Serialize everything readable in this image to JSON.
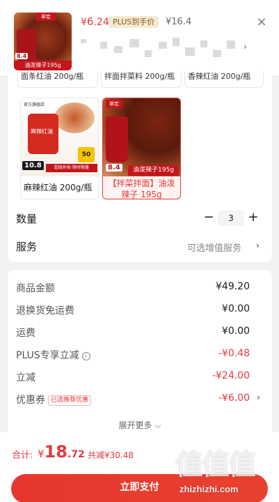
{
  "header": {
    "thumb_brand": "翠宏",
    "thumb_price_tag": "8.4",
    "thumb_strip": "油泼辣子195g",
    "price_currency": "¥",
    "price_int": "6",
    "price_dec": ".24",
    "plus_tag": "PLUS到手价",
    "original_price": "¥16.4",
    "close_icon": "close-icon",
    "chevron": "›"
  },
  "spec": {
    "previous_row": [
      "面条红油 200g/瓶",
      "拌面拌菜料 200g/瓶",
      "香辣红油 200g/瓶"
    ],
    "options": [
      {
        "shop": "官方旗舰店",
        "jar_text": "麻辣红油",
        "badge": "50",
        "price_bar": "10.8",
        "subsidy": "超级补贴 限时限量",
        "label": "麻辣红油 200g/瓶",
        "selected": false
      },
      {
        "brand": "翠宏",
        "price_tag": "8.4",
        "strip": "油泼辣子195g",
        "label": "【拌菜拌面】油泼辣子 195g",
        "selected": true
      }
    ]
  },
  "quantity": {
    "label": "数量",
    "value": "3",
    "minus": "−",
    "plus": "+"
  },
  "service": {
    "label": "服务",
    "value": "可选增值服务",
    "chevron": "›"
  },
  "price_details": {
    "rows": [
      {
        "key": "商品金额",
        "value": "¥49.20"
      },
      {
        "key": "退换货免运费",
        "value": "¥0.00"
      },
      {
        "key": "运费",
        "value": "¥0.00"
      },
      {
        "key": "PLUS专享立减",
        "value": "-¥0.48",
        "info": "i"
      },
      {
        "key": "立减",
        "value": "-¥24.00"
      },
      {
        "key": "优惠券",
        "value": "-¥6.00",
        "tag": "已选推荐优惠"
      }
    ],
    "coupon_chevron": "›",
    "expand_label": "展开更多 ⌵"
  },
  "bottom": {
    "total_label": "合计:",
    "total_currency": "¥",
    "total_int": "18",
    "total_dec": ".72",
    "saved": "共减¥30.48",
    "pay_button": "立即支付",
    "watermark_glyphs": "值值值",
    "watermark_url": "zhizhizhi.com"
  },
  "colors": {
    "accent": "#e4393c",
    "plus_bg": "#f4ead2",
    "plus_text": "#8a5a1b"
  }
}
